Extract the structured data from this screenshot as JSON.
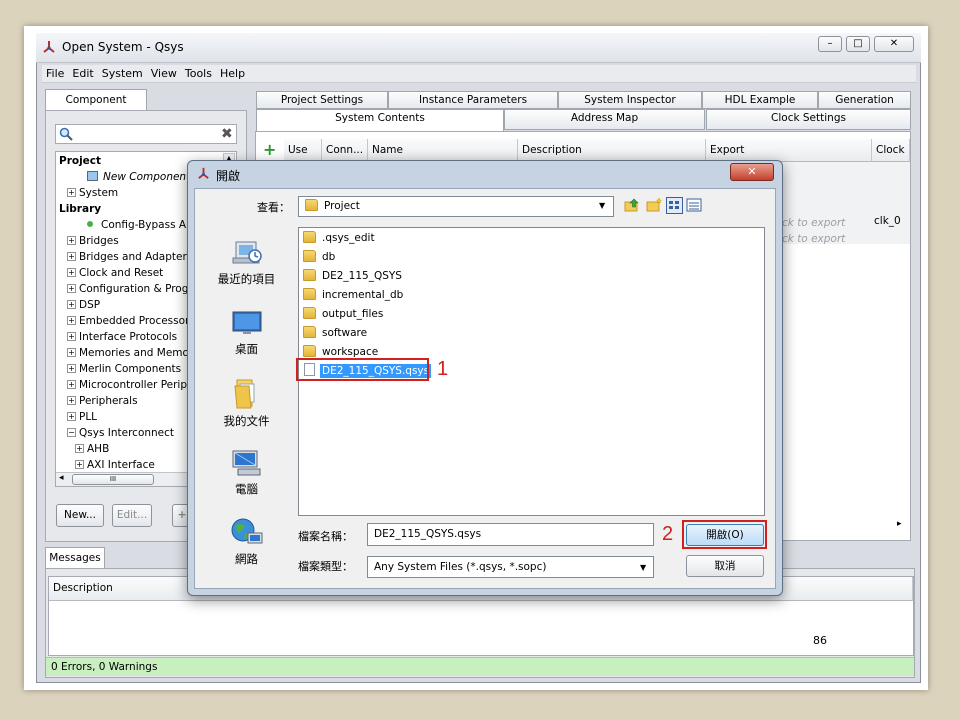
{
  "window": {
    "title": "Open System - Qsys",
    "controls": [
      "–",
      "□",
      "✕"
    ]
  },
  "menu": [
    "File",
    "Edit",
    "System",
    "View",
    "Tools",
    "Help"
  ],
  "component_library": {
    "tab": "Component Library",
    "tree": [
      {
        "label": "Project",
        "bold": true,
        "indent": 0
      },
      {
        "label": "New Component...",
        "italic": true,
        "indent": 2
      },
      {
        "label": "System",
        "indent": 1,
        "expander": "+"
      },
      {
        "label": "Library",
        "bold": true,
        "indent": 0
      },
      {
        "label": "Config-Bypass Ap",
        "indent": 2,
        "dot": true
      },
      {
        "label": "Bridges",
        "indent": 1,
        "expander": "+"
      },
      {
        "label": "Bridges and Adapters",
        "indent": 1,
        "expander": "+"
      },
      {
        "label": "Clock and Reset",
        "indent": 1,
        "expander": "+"
      },
      {
        "label": "Configuration & Progra",
        "indent": 1,
        "expander": "+"
      },
      {
        "label": "DSP",
        "indent": 1,
        "expander": "+"
      },
      {
        "label": "Embedded Processors",
        "indent": 1,
        "expander": "+"
      },
      {
        "label": "Interface Protocols",
        "indent": 1,
        "expander": "+"
      },
      {
        "label": "Memories and Memory",
        "indent": 1,
        "expander": "+"
      },
      {
        "label": "Merlin Components",
        "indent": 1,
        "expander": "+"
      },
      {
        "label": "Microcontroller Periphe",
        "indent": 1,
        "expander": "+"
      },
      {
        "label": "Peripherals",
        "indent": 1,
        "expander": "+"
      },
      {
        "label": "PLL",
        "indent": 1,
        "expander": "+"
      },
      {
        "label": "Qsys Interconnect",
        "indent": 1,
        "expander": "−"
      },
      {
        "label": "AHB",
        "indent": 2,
        "expander": "+"
      },
      {
        "label": "AXI Interface",
        "indent": 2,
        "expander": "+"
      }
    ],
    "scroll_thumb": "III",
    "new_button": "New...",
    "edit_button": "Edit...",
    "add_button": "+"
  },
  "tabs_row1": [
    "Project Settings",
    "Instance Parameters",
    "System Inspector",
    "HDL Example",
    "Generation"
  ],
  "tabs_row2": [
    "System Contents",
    "Address Map",
    "Clock Settings"
  ],
  "table": {
    "headers": [
      "Use",
      "Conn...",
      "Name",
      "Description",
      "Export",
      "Clock"
    ],
    "clock_value": "clk_0",
    "export_hint_1": "ck to export",
    "export_hint_2": "ck to export"
  },
  "messages": {
    "tab": "Messages",
    "header": "Description",
    "status": "0 Errors, 0 Warnings",
    "page_number": "86"
  },
  "dialog": {
    "title": "開啟",
    "look_in_label": "查看：",
    "look_in_value": "Project",
    "places": [
      "最近的項目",
      "桌面",
      "我的文件",
      "電腦",
      "網路"
    ],
    "files": [
      {
        "name": ".qsys_edit",
        "type": "folder"
      },
      {
        "name": "db",
        "type": "folder"
      },
      {
        "name": "DE2_115_QSYS",
        "type": "folder"
      },
      {
        "name": "incremental_db",
        "type": "folder"
      },
      {
        "name": "output_files",
        "type": "folder"
      },
      {
        "name": "software",
        "type": "folder"
      },
      {
        "name": "workspace",
        "type": "folder"
      },
      {
        "name": "DE2_115_QSYS.qsys",
        "type": "file",
        "selected": true
      }
    ],
    "filename_label": "檔案名稱：",
    "filename_value": "DE2_115_QSYS.qsys",
    "filetype_label": "檔案類型：",
    "filetype_value": "Any System Files (*.qsys, *.sopc)",
    "open_button": "開啟(O)",
    "cancel_button": "取消",
    "close": "✕"
  },
  "annotations": {
    "marker_1": "1",
    "marker_2": "2"
  },
  "colors": {
    "selection": "#3399ff",
    "annotation_red": "#d0201f",
    "status_bar": "#c8f0bf"
  }
}
